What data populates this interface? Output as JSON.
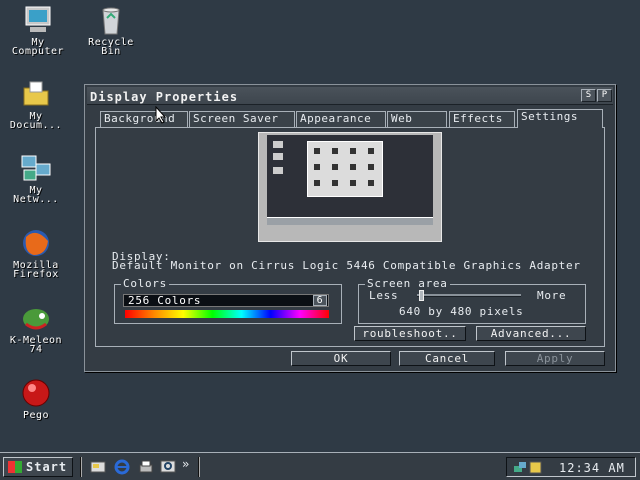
{
  "desktop": {
    "icons": [
      {
        "label": "My\nComputer",
        "icon": "computer-icon"
      },
      {
        "label": "Recycle\nBin",
        "icon": "recycle-bin-icon"
      },
      {
        "label": "My\nDocum...",
        "icon": "folder-icon"
      },
      {
        "label": "My\nNetw...",
        "icon": "network-icon"
      },
      {
        "label": "Mozilla\nFirefox",
        "icon": "firefox-icon"
      },
      {
        "label": "K-Meleon\n74",
        "icon": "kmeleon-icon"
      },
      {
        "label": "Pego",
        "icon": "pego-icon"
      }
    ]
  },
  "window": {
    "title": "Display Properties",
    "title_buttons": [
      "S",
      "P"
    ],
    "tabs": [
      "Background",
      "Screen Saver",
      "Appearance",
      "Web",
      "Effects",
      "Settings"
    ],
    "active_tab": "Settings",
    "display_label": "Display:",
    "display_value": "Default Monitor on Cirrus Logic 5446 Compatible Graphics Adapter",
    "colors": {
      "legend": "Colors",
      "value": "256 Colors",
      "dropdown_glyph": "6"
    },
    "screen_area": {
      "legend": "Screen area",
      "less": "Less",
      "more": "More",
      "value": "640 by 480 pixels",
      "slider_position": 0.0
    },
    "buttons": {
      "troubleshoot": "roubleshoot..",
      "advanced": "Advanced...",
      "ok": "OK",
      "cancel": "Cancel",
      "apply": "Apply"
    }
  },
  "taskbar": {
    "start_label": "Start",
    "quicklaunch": [
      "desktop-icon",
      "ie-icon",
      "printer-icon",
      "search-icon"
    ],
    "chevron": "»",
    "clock": "12:34 AM"
  },
  "colors": {
    "desktop": "#2f3a45",
    "window": "#343c44",
    "spectrum": [
      "#ff0000",
      "#ffff00",
      "#00ff00",
      "#00ffff",
      "#0000ff",
      "#ff00ff"
    ]
  }
}
